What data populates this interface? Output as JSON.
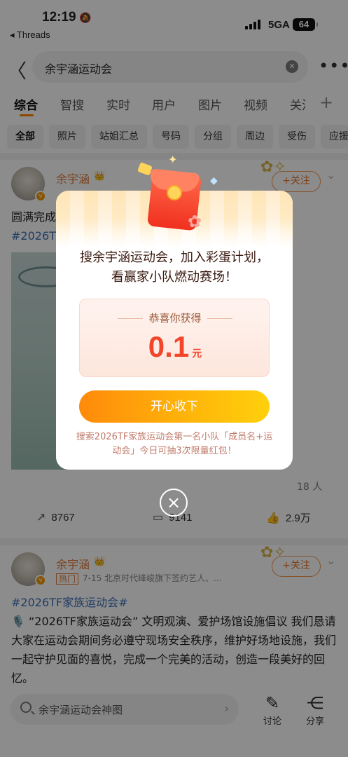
{
  "status_bar": {
    "time": "12:19",
    "back_app": "◂ Threads",
    "network": "5GA",
    "battery": "64"
  },
  "search": {
    "query": "余宇涵运动会",
    "more": "•••"
  },
  "tabs": [
    {
      "label": "综合"
    },
    {
      "label": "智搜"
    },
    {
      "label": "实时"
    },
    {
      "label": "用户"
    },
    {
      "label": "图片"
    },
    {
      "label": "视频"
    },
    {
      "label": "关注"
    }
  ],
  "chips": [
    "全部",
    "照片",
    "站姐汇总",
    "号码",
    "分组",
    "周边",
    "受伤",
    "应援"
  ],
  "post1": {
    "author": "余宇涵",
    "follow": "+关注",
    "text_line1": "圆满完成",
    "tag": "#2026T",
    "people_count": "18 人",
    "actions": {
      "share": "8767",
      "comment": "9141",
      "like": "2.9万"
    }
  },
  "post2": {
    "author": "余宇涵",
    "follow": "+关注",
    "hot": "热门",
    "meta": "7-15  北京时代峰峻旗下签约艺人、...",
    "tag": "#2026TF家族运动会#",
    "body": "🎙️ “2026TF家族运动会” 文明观演、爱护场馆设施倡议 我们恳请大家在运动会期间务必遵守现场安全秩序，维护好场地设施，我们一起守护见面的喜悦，完成一个完美的活动，创造一段美好的回忆。"
  },
  "bottom_bar": {
    "search_placeholder": "余宇涵运动会神图",
    "comment_label": "讨论",
    "share_label": "分享"
  },
  "modal": {
    "title": "搜余宇涵运动会，加入彩蛋计划，看赢家小队燃动赛场！",
    "prize_label": "恭喜你获得",
    "prize_amount": "0.1",
    "prize_unit": "元",
    "accept_button": "开心收下",
    "note": "搜索2026TF家族运动会第一名小队「成员名+运动会」今日可抽3次限量红包！",
    "close": "×"
  },
  "colors": {
    "accent": "#ff8200",
    "prize_red": "#f2452a",
    "link_blue": "#3b6fb6"
  }
}
